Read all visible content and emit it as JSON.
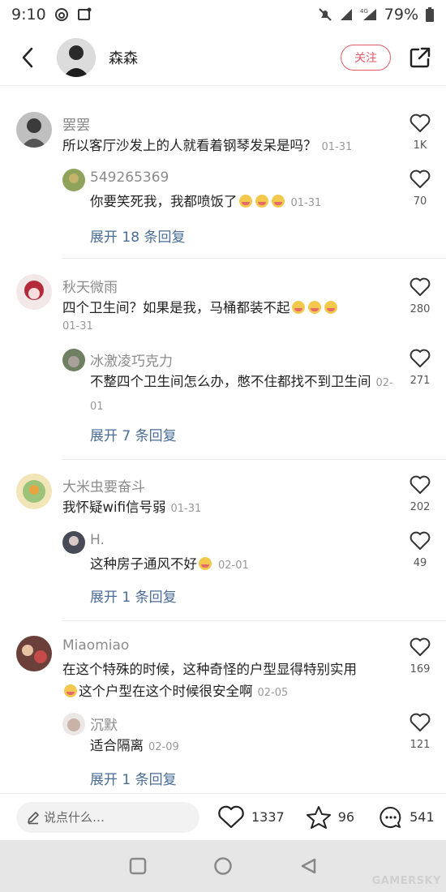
{
  "status": {
    "time": "9:10",
    "battery": "79%",
    "network": "4G"
  },
  "header": {
    "username": "森森",
    "follow_label": "关注"
  },
  "comments": [
    {
      "user": "罢罢",
      "text": "所以客厅沙发上的人就看着钢琴发呆是吗？",
      "date": "01-31",
      "likes": "1K",
      "reply": {
        "user": "549265369",
        "text": "你要笑死我，我都喷饭了",
        "date": "01-31",
        "likes": "70"
      },
      "expand": "展开 18 条回复"
    },
    {
      "user": "秋天微雨",
      "text": "四个卫生间？如果是我，马桶都装不起",
      "date": "01-31",
      "likes": "280",
      "reply": {
        "user": "冰激凌巧克力",
        "text": "不整四个卫生间怎么办，憋不住都找不到卫生间",
        "date": "02-01",
        "likes": "271"
      },
      "expand": "展开 7 条回复"
    },
    {
      "user": "大米虫要奋斗",
      "text": "我怀疑wifi信号弱",
      "date": "01-31",
      "likes": "202",
      "reply": {
        "user": "H.",
        "text": "这种房子通风不好",
        "date": "02-01",
        "likes": "49"
      },
      "expand": "展开 1 条回复"
    },
    {
      "user": "Miaomiao",
      "text": "在这个特殊的时候，这种奇怪的户型显得特别实用",
      "text2": "这个户型在这个时候很安全啊",
      "date": "02-05",
      "likes": "169",
      "reply": {
        "user": "沉默",
        "text": "适合隔离",
        "date": "02-09",
        "likes": "121"
      },
      "expand": "展开 1 条回复"
    }
  ],
  "bottom": {
    "placeholder": "说点什么…",
    "likes": "1337",
    "stars": "96",
    "comments": "541"
  },
  "watermark": "GAMERSKY",
  "colors": {
    "accent": "#e25a67",
    "link": "#4a6c97"
  }
}
